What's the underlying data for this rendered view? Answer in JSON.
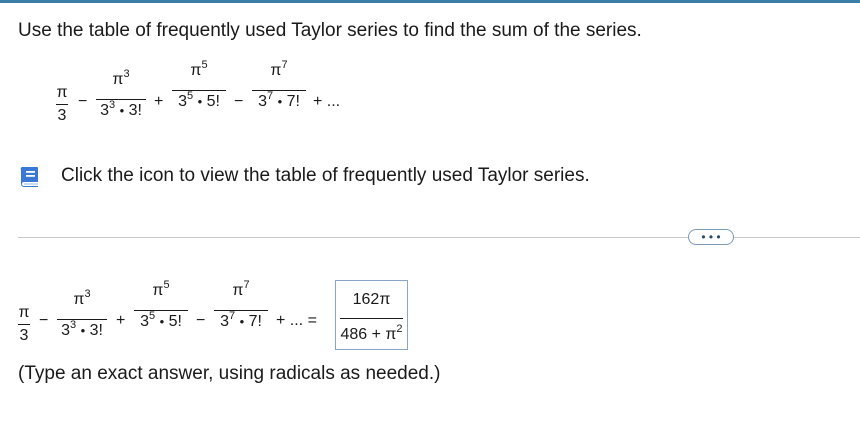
{
  "question": "Use the table of frequently used Taylor series to find the sum of the series.",
  "series_terms": [
    {
      "num": "π",
      "den": "3"
    },
    {
      "num_base": "π",
      "num_exp": "3",
      "den_base": "3",
      "den_exp": "3",
      "den_fact": "3!"
    },
    {
      "num_base": "π",
      "num_exp": "5",
      "den_base": "3",
      "den_exp": "5",
      "den_fact": "5!"
    },
    {
      "num_base": "π",
      "num_exp": "7",
      "den_base": "3",
      "den_exp": "7",
      "den_fact": "7!"
    }
  ],
  "ops": {
    "minus": "−",
    "plus": "+",
    "dot": "•",
    "ellipsis_plus": "+ ...",
    "ellipsis_eq": "+ ... ="
  },
  "hint": {
    "text": "Click the icon to view the table of frequently used Taylor series.",
    "icon": "book-icon"
  },
  "more_button": "• • •",
  "answer": {
    "num": "162π",
    "den_prefix": "486 + π",
    "den_exp": "2"
  },
  "note": "(Type an exact answer, using radicals as needed.)",
  "colors": {
    "accent": "#3b7fa6",
    "icon": "#3a78d6"
  }
}
